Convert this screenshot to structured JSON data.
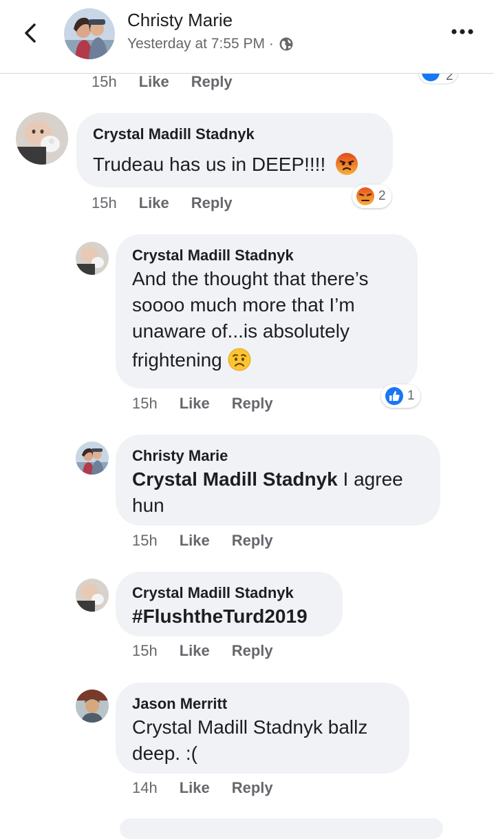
{
  "header": {
    "name": "Christy Marie",
    "time": "Yesterday at 7:55 PM ·"
  },
  "top_partial": {
    "time": "15h",
    "like": "Like",
    "reply": "Reply"
  },
  "comments": [
    {
      "author": "Crystal Madill Stadnyk",
      "text": "Trudeau has us in DEEP!!!!",
      "time": "15h",
      "like": "Like",
      "reply": "Reply",
      "reaction_count": "2",
      "reaction_icon": "angry-reaction-icon"
    },
    {
      "author": "Crystal Madill Stadnyk",
      "text_line1": "And the thought that there’s",
      "text_line2": "soooo much more that I’m",
      "text_line3": "unaware of...is absolutely",
      "text_line4": "frightening",
      "time": "15h",
      "like": "Like",
      "reply": "Reply",
      "reaction_count": "1",
      "reaction_icon": "like-reaction-icon"
    },
    {
      "author": "Christy Marie",
      "mention": "Crystal Madill Stadnyk",
      "text_rest": " I agree",
      "text_line2": "hun",
      "time": "15h",
      "like": "Like",
      "reply": "Reply"
    },
    {
      "author": "Crystal Madill Stadnyk",
      "text": "#FlushtheTurd2019",
      "time": "15h",
      "like": "Like",
      "reply": "Reply"
    },
    {
      "author": "Jason Merritt",
      "text_line1": "Crystal Madill Stadnyk ballz",
      "text_line2": "deep. :(",
      "time": "14h",
      "like": "Like",
      "reply": "Reply"
    }
  ],
  "colors": {
    "bubble": "#f0f2f5",
    "meta_text": "#65676b",
    "like_blue": "#1877f2",
    "angry_orange": "#e9710f"
  }
}
